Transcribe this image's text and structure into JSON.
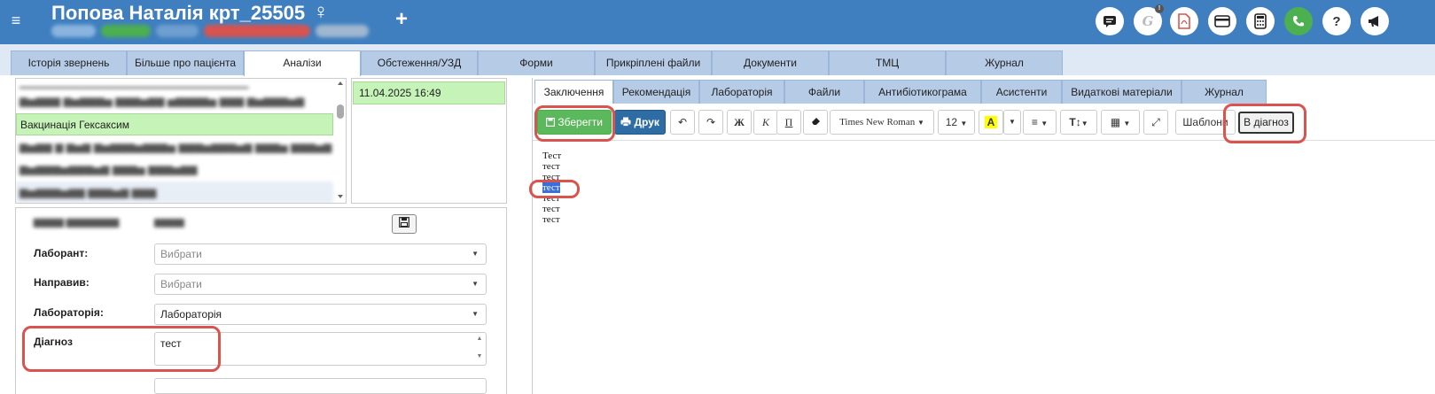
{
  "header": {
    "menu_icon": "hamburger-icon",
    "patient_name": "Попова Наталія крт_25505",
    "gender_symbol": "♀",
    "add_symbol": "+",
    "icons": [
      "chat-icon",
      "signature-icon",
      "pdf-icon",
      "card-icon",
      "calculator-icon",
      "phone-icon",
      "help-icon",
      "announce-icon"
    ],
    "badge": "!"
  },
  "main_tabs": [
    {
      "label": "Історія звернень"
    },
    {
      "label": "Більше про пацієнта"
    },
    {
      "label": "Аналізи"
    },
    {
      "label": "Обстеження/УЗД"
    },
    {
      "label": "Форми"
    },
    {
      "label": "Прикріплені файли"
    },
    {
      "label": "Документи"
    },
    {
      "label": "ТМЦ"
    },
    {
      "label": "Журнал"
    }
  ],
  "analyses_list": {
    "selected_item": "Вакцинація Гексаксим"
  },
  "dates": [
    "11.04.2025 16:49"
  ],
  "form": {
    "labels": {
      "laborant": "Лаборант:",
      "referred": "Направив:",
      "laboratory": "Лабораторія:",
      "diagnosis": "Діагноз"
    },
    "placeholders": {
      "laborant": "Вибрати",
      "referred": "Вибрати"
    },
    "values": {
      "laboratory": "Лабораторія",
      "diagnosis": "тест"
    }
  },
  "sub_tabs": [
    {
      "label": "Заключення"
    },
    {
      "label": "Рекомендація"
    },
    {
      "label": "Лабораторія"
    },
    {
      "label": "Файли"
    },
    {
      "label": "Антибіотикограма"
    },
    {
      "label": "Асистенти"
    },
    {
      "label": "Видаткові матеріали"
    },
    {
      "label": "Журнал"
    }
  ],
  "toolbar": {
    "save_label": "Зберегти",
    "print_label": "Друк",
    "bold_label": "Ж",
    "italic_label": "К",
    "underline_label": "П",
    "font_name": "Times New Roman",
    "font_size": "12",
    "highlight_label": "A",
    "templates_label": "Шаблони",
    "to_diagnosis_label": "В діагноз"
  },
  "editor": {
    "lines": [
      "Тест",
      "тест",
      "тест",
      "тест",
      "тест",
      "тест",
      "тест"
    ],
    "selected_line_index": 3
  },
  "colors": {
    "header": "#3f7fbf",
    "tab": "#b5cbe6",
    "selection_green": "#c6f3b8",
    "save_green": "#5cb85c",
    "print_blue": "#2e6da4",
    "annotation_red": "#d9534f"
  }
}
